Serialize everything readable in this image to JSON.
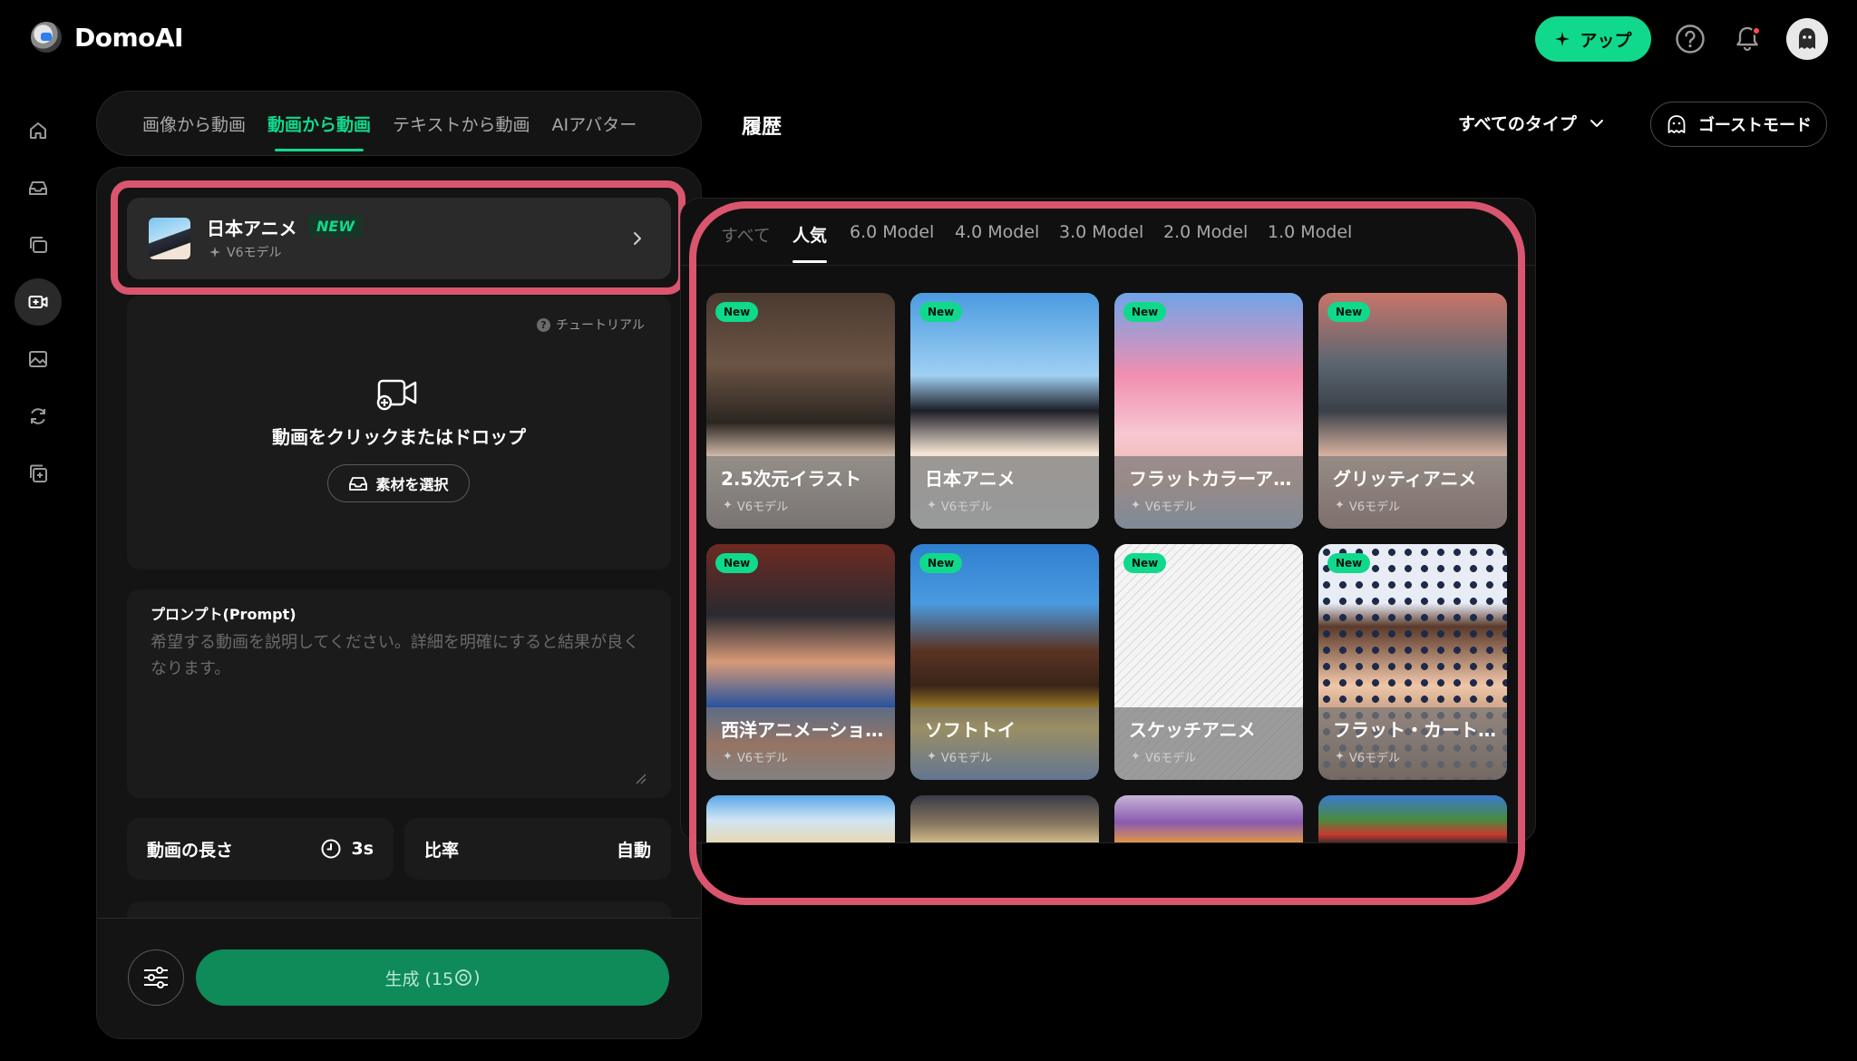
{
  "app": {
    "name": "DomoAI"
  },
  "header": {
    "upgrade_label": "アップ",
    "help_icon": "question-circle-icon",
    "bell_icon": "bell-icon",
    "avatar_icon": "ghost-avatar-icon"
  },
  "sidebar": {
    "items": [
      {
        "icon": "home-icon"
      },
      {
        "icon": "inbox-icon"
      },
      {
        "icon": "layers-icon"
      },
      {
        "icon": "video-add-icon",
        "active": true
      },
      {
        "icon": "image-icon"
      },
      {
        "icon": "refresh-icon"
      },
      {
        "icon": "copy-plus-icon"
      }
    ]
  },
  "mode_tabs": [
    {
      "label": "画像から動画"
    },
    {
      "label": "動画から動画",
      "active": true
    },
    {
      "label": "テキストから動画"
    },
    {
      "label": "AIアバター"
    }
  ],
  "selected_style": {
    "name": "日本アニメ",
    "badge": "NEW",
    "model": "V6モデル"
  },
  "upload": {
    "tutorial": "チュートリアル",
    "text": "動画をクリックまたはドロップ",
    "material_button": "素材を選択"
  },
  "prompt": {
    "label": "プロンプト(Prompt)",
    "placeholder": "希望する動画を説明してください。詳細を明確にすると結果が良くなります。",
    "value": ""
  },
  "settings": {
    "length_label": "動画の長さ",
    "length_value": "3s",
    "ratio_label": "比率",
    "ratio_value": "自動"
  },
  "generate": {
    "label": "生成 (15",
    "credit_suffix": ")"
  },
  "history": {
    "title": "履歴",
    "type_filter": "すべてのタイプ",
    "ghost_mode": "ゴーストモード"
  },
  "picker": {
    "tabs": [
      "すべて",
      "人気",
      "6.0 Model",
      "4.0 Model",
      "3.0 Model",
      "2.0 Model",
      "1.0 Model"
    ],
    "active_tab": "人気",
    "cards": [
      {
        "name": "2.5次元イラスト",
        "model": "V6モデル",
        "badge": "New"
      },
      {
        "name": "日本アニメ",
        "model": "V6モデル",
        "badge": "New",
        "selected": true
      },
      {
        "name": "フラットカラーア...",
        "model": "V6モデル",
        "badge": "New"
      },
      {
        "name": "グリッティアニメ",
        "model": "V6モデル",
        "badge": "New"
      },
      {
        "name": "西洋アニメーショ...",
        "model": "V6モデル",
        "badge": "New"
      },
      {
        "name": "ソフトトイ",
        "model": "V6モデル",
        "badge": "New"
      },
      {
        "name": "スケッチアニメ",
        "model": "V6モデル",
        "badge": "New"
      },
      {
        "name": "フラット・カート...",
        "model": "V6モデル",
        "badge": "New"
      }
    ]
  },
  "colors": {
    "accent": "#10d98c",
    "highlight": "#d9566e",
    "generate": "#0f8a59"
  }
}
